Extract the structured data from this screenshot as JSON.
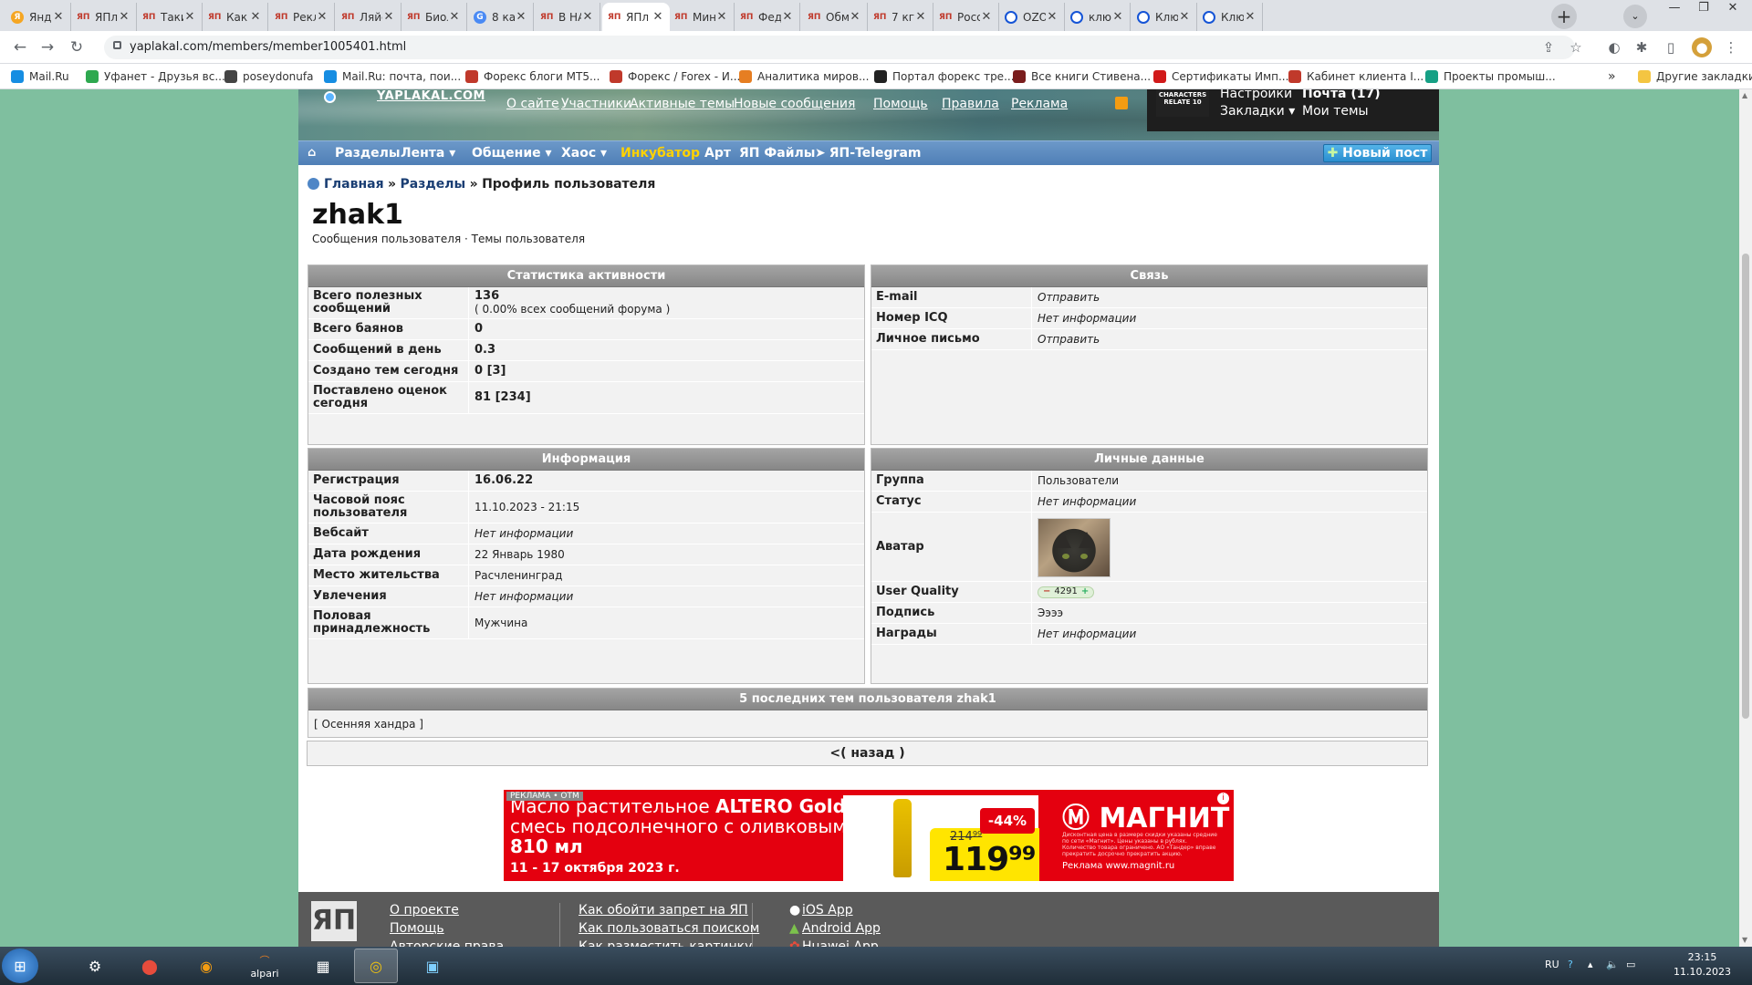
{
  "browser": {
    "tabs": [
      {
        "title": "Янде",
        "icon": "yandex"
      },
      {
        "title": "ЯПл",
        "icon": "yap"
      },
      {
        "title": "Таки",
        "icon": "yap"
      },
      {
        "title": "Как",
        "icon": "yap"
      },
      {
        "title": "Рекл",
        "icon": "yap"
      },
      {
        "title": "Ляйс",
        "icon": "yap"
      },
      {
        "title": "Биол",
        "icon": "yap"
      },
      {
        "title": "8 ка",
        "icon": "google"
      },
      {
        "title": "В НА",
        "icon": "yap"
      },
      {
        "title": "ЯПл",
        "icon": "yap"
      },
      {
        "title": "Мин",
        "icon": "yap"
      },
      {
        "title": "Фед",
        "icon": "yap"
      },
      {
        "title": "Обм",
        "icon": "yap"
      },
      {
        "title": "7 кг",
        "icon": "yap"
      },
      {
        "title": "Росс",
        "icon": "yap"
      },
      {
        "title": "OZO",
        "icon": "ozon"
      },
      {
        "title": "клю",
        "icon": "ozon"
      },
      {
        "title": "Клю",
        "icon": "ozon"
      },
      {
        "title": "Клю",
        "icon": "ozon"
      }
    ],
    "active_tab": 9,
    "url": "yaplakal.com/members/member1005401.html",
    "bookmarks": [
      {
        "label": "Mail.Ru",
        "color": "#168de2"
      },
      {
        "label": "Уфанет - Друзья вс...",
        "color": "#2ea84f"
      },
      {
        "label": "poseydonufa",
        "color": "#444444"
      },
      {
        "label": "Mail.Ru: почта, пои...",
        "color": "#168de2"
      },
      {
        "label": "Форекс блоги MT5...",
        "color": "#c0392b"
      },
      {
        "label": "Форекс / Forex - И...",
        "color": "#c0392b"
      },
      {
        "label": "Аналитика миров...",
        "color": "#e67e22"
      },
      {
        "label": "Портал форекс тре...",
        "color": "#222222"
      },
      {
        "label": "Все книги Стивена...",
        "color": "#7a1d1d"
      },
      {
        "label": "Сертификаты Имп...",
        "color": "#d11a1a"
      },
      {
        "label": "Кабинет клиента I...",
        "color": "#c0392b"
      },
      {
        "label": "Проекты промыш...",
        "color": "#16a085"
      }
    ],
    "bookmarks_more": "»",
    "other_bookmarks": "Другие закладки"
  },
  "site": {
    "logo": "YAPLAKAL.COM",
    "top_links": [
      "О сайте",
      "Участники",
      "Активные темы",
      "Новые сообщения",
      "Помощь",
      "Правила",
      "Реклама"
    ],
    "userbox": {
      "promo": "CHARACTERS RELATE 10",
      "settings": "Настройки",
      "mail": "Почта (17)",
      "bookmarks": "Закладки",
      "my_topics": "Мои темы"
    },
    "nav": [
      {
        "label": "Разделы",
        "highlight": false
      },
      {
        "label": "Лента ▾",
        "highlight": false
      },
      {
        "label": "Общение ▾",
        "highlight": false
      },
      {
        "label": "Хаос ▾",
        "highlight": false
      },
      {
        "label": "Инкубатор",
        "highlight": true
      },
      {
        "label": "Арт",
        "highlight": false
      },
      {
        "label": "ЯП Файлы",
        "highlight": false
      },
      {
        "label": "ЯП-Telegram",
        "highlight": false
      }
    ],
    "new_post": "Новый пост",
    "breadcrumb": {
      "home": "Главная",
      "sep": "»",
      "sections": "Разделы",
      "current": "Профиль пользователя"
    },
    "username": "zhak1",
    "user_links": {
      "posts": "Сообщения пользователя",
      "sep": "·",
      "topics": "Темы пользователя"
    }
  },
  "panels": {
    "activity": {
      "title": "Статистика активности",
      "rows": [
        {
          "k": "Всего полезных сообщений",
          "v": "136",
          "v2": "( 0.00% всех сообщений форума )"
        },
        {
          "k": "Всего баянов",
          "v": "0"
        },
        {
          "k": "Сообщений в день",
          "v": "0.3"
        },
        {
          "k": "Создано тем сегодня",
          "v": "0 [3]"
        },
        {
          "k": "Поставлено оценок сегодня",
          "v": "81 [234]"
        }
      ]
    },
    "contact": {
      "title": "Связь",
      "rows": [
        {
          "k": "E-mail",
          "v": "Отправить"
        },
        {
          "k": "Номер ICQ",
          "v": "Нет информации"
        },
        {
          "k": "Личное письмо",
          "v": "Отправить"
        }
      ]
    },
    "info": {
      "title": "Информация",
      "rows": [
        {
          "k": "Регистрация",
          "v": "16.06.22"
        },
        {
          "k": "Часовой пояс пользователя",
          "v": "11.10.2023 - 21:15"
        },
        {
          "k": "Вебсайт",
          "v": "Нет информации"
        },
        {
          "k": "Дата рождения",
          "v": "22 Январь 1980"
        },
        {
          "k": "Место жительства",
          "v": "Расчленинград"
        },
        {
          "k": "Увлечения",
          "v": "Нет информации"
        },
        {
          "k": "Половая принадлежность",
          "v": "Мужчина"
        }
      ]
    },
    "personal": {
      "title": "Личные данные",
      "rows": [
        {
          "k": "Группа",
          "v": "Пользователи"
        },
        {
          "k": "Статус",
          "v": "Нет информации"
        },
        {
          "k": "Аватар",
          "v": ""
        },
        {
          "k": "User Quality",
          "v": "4291"
        },
        {
          "k": "Подпись",
          "v": "Ээээ"
        },
        {
          "k": "Награды",
          "v": "Нет информации"
        }
      ]
    },
    "recent": {
      "title": "5 последних тем пользователя zhak1",
      "open": "[",
      "item": "Осенняя хандра",
      "close": "]"
    }
  },
  "back": {
    "prefix": "<(",
    "link": "назад",
    "suffix": ")"
  },
  "ad": {
    "tag": "РЕКЛАМА • ОТМ",
    "line1_prefix": "Масло растительное ",
    "line1_bold": "ALTERO Gold,",
    "line2": "смесь подсолнечного с оливковым,",
    "line3": "810 мл",
    "dates": "11 - 17 октября 2023 г.",
    "old_price": "214⁹⁹",
    "new_price": "119⁹⁹",
    "discount": "-44%",
    "brand": "МАГНИТ",
    "fine": "Дисконтная цена в размере скидки указаны средние по сети «Магнит». Цены указаны в рублях. Количество товара ограничено. АО «Тандер» вправе прекратить досрочно прекратить акцию.",
    "site": "Реклама www.magnit.ru"
  },
  "footer": {
    "logo": "ЯП",
    "col1": [
      "О проекте",
      "Помощь",
      "Авторские права"
    ],
    "col2": [
      "Как обойти запрет на ЯП",
      "Как пользоваться поиском",
      "Как разместить картинку"
    ],
    "col3": [
      "iOS App",
      "Android App",
      "Huawei App"
    ]
  },
  "taskbar": {
    "apps": [
      "start",
      "steam",
      "app-red",
      "firefox",
      "alpari",
      "calculator",
      "chrome",
      "photo-viewer"
    ],
    "alpari_label": "alpari",
    "lang": "RU",
    "time": "23:15",
    "date": "11.10.2023"
  }
}
